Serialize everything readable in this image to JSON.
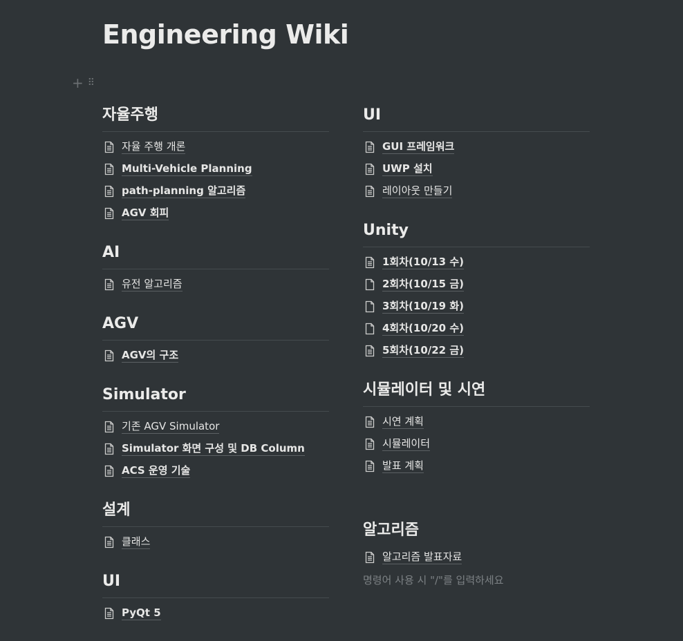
{
  "page": {
    "title": "Engineering Wiki"
  },
  "left_column": [
    {
      "heading": "자율주행",
      "items": [
        {
          "label": "자율 주행 개론",
          "icon": "page-text-icon"
        },
        {
          "label": "Multi-Vehicle Planning",
          "icon": "page-text-icon"
        },
        {
          "label": "path-planning 알고리즘",
          "icon": "page-text-icon"
        },
        {
          "label": "AGV 회피",
          "icon": "page-text-icon"
        }
      ]
    },
    {
      "heading": "AI",
      "items": [
        {
          "label": "유전 알고리즘",
          "icon": "page-text-icon"
        }
      ]
    },
    {
      "heading": "AGV",
      "items": [
        {
          "label": "AGV의 구조",
          "icon": "page-text-icon"
        }
      ]
    },
    {
      "heading": "Simulator",
      "items": [
        {
          "label": "기존 AGV Simulator",
          "icon": "page-text-icon"
        },
        {
          "label": "Simulator 화면 구성 및 DB Column",
          "icon": "page-text-icon"
        },
        {
          "label": "ACS 운영 기술",
          "icon": "page-text-icon"
        }
      ]
    },
    {
      "heading": "설계",
      "items": [
        {
          "label": "클래스",
          "icon": "page-text-icon"
        }
      ]
    },
    {
      "heading": "UI",
      "items": [
        {
          "label": "PyQt 5",
          "icon": "page-text-icon"
        }
      ]
    }
  ],
  "right_column": [
    {
      "heading": "UI",
      "items": [
        {
          "label": "GUI 프레임워크",
          "icon": "page-text-icon"
        },
        {
          "label": "UWP 설치",
          "icon": "page-text-icon"
        },
        {
          "label": "레이아웃 만들기",
          "icon": "page-text-icon"
        }
      ]
    },
    {
      "heading": "Unity",
      "items": [
        {
          "label": "1회차(10/13 수)",
          "icon": "page-text-icon"
        },
        {
          "label": "2회차(10/15 금)",
          "icon": "page-empty-icon"
        },
        {
          "label": "3회차(10/19 화)",
          "icon": "page-empty-icon"
        },
        {
          "label": "4회차(10/20 수)",
          "icon": "page-empty-icon"
        },
        {
          "label": "5회차(10/22 금)",
          "icon": "page-text-icon"
        }
      ]
    },
    {
      "heading": "시뮬레이터 및 시연",
      "items": [
        {
          "label": "시연 계획",
          "icon": "page-text-icon"
        },
        {
          "label": "시뮬레이터",
          "icon": "page-text-icon"
        },
        {
          "label": "발표 계획",
          "icon": "page-text-icon"
        }
      ]
    },
    {
      "heading": "알고리즘",
      "items": [
        {
          "label": "알고리즘 발표자료",
          "icon": "page-text-icon"
        }
      ]
    }
  ],
  "editor": {
    "placeholder": "명령어 사용 시 \"/\"를 입력하세요"
  },
  "colors": {
    "background": "#2f3437",
    "text": "#ebebea",
    "divider": "#454b4e",
    "muted": "#7d8285"
  }
}
